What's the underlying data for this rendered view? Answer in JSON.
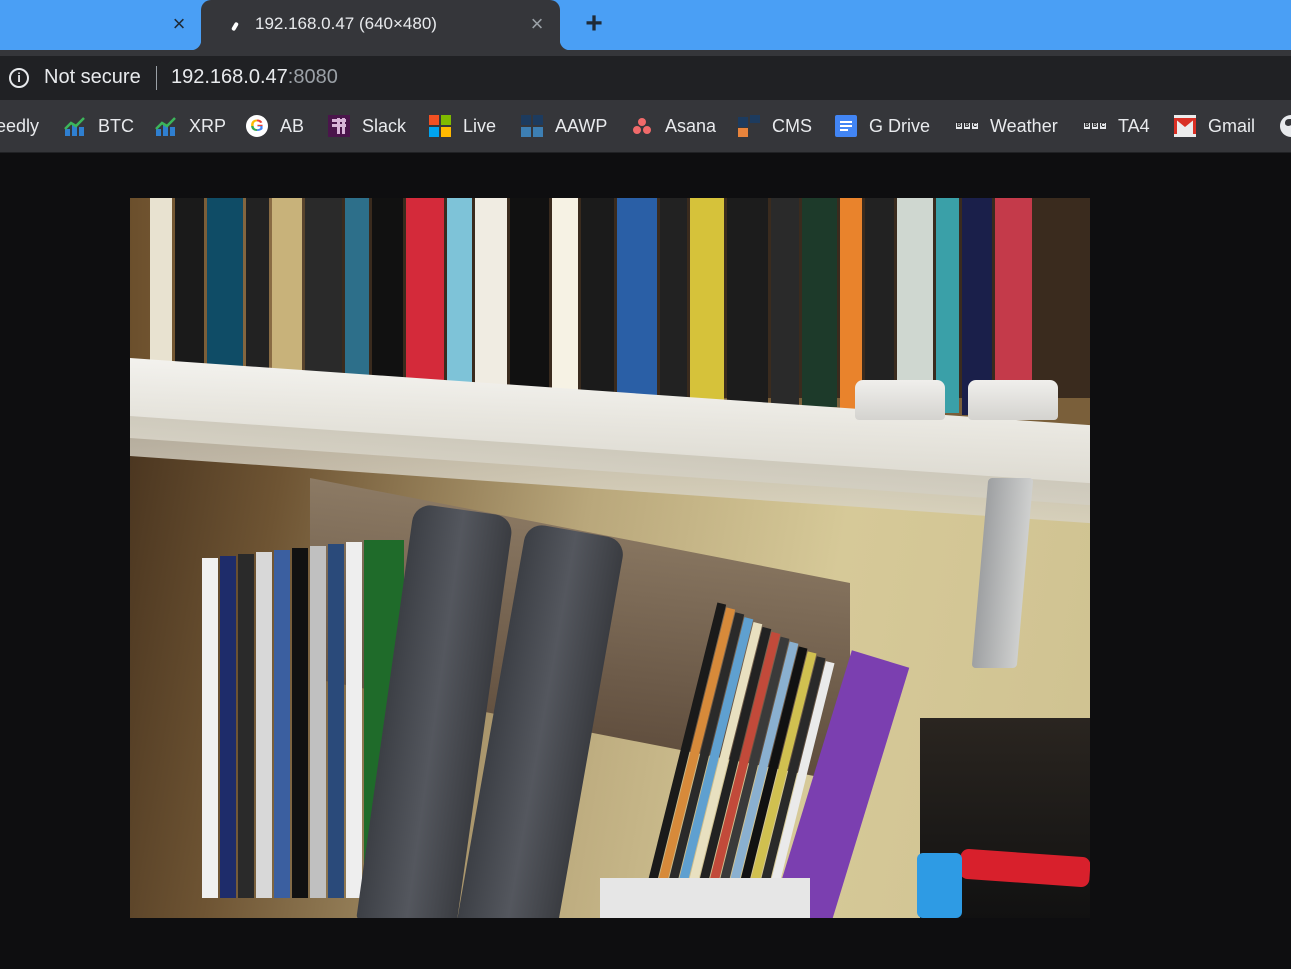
{
  "browser": {
    "tabs": [
      {
        "title": "",
        "active": false,
        "close_glyph": "×"
      },
      {
        "title": "192.168.0.47 (640×480)",
        "active": true,
        "close_glyph": "×",
        "favicon": "image-loading-icon"
      }
    ],
    "new_tab_glyph": "+",
    "accent_color": "#4a9ff5"
  },
  "omnibox": {
    "security_icon": "info-icon",
    "security_label": "Not secure",
    "url_host": "192.168.0.47",
    "url_port": ":8080"
  },
  "bookmarks": [
    {
      "label": "eedly",
      "icon": "feedly-icon"
    },
    {
      "label": "BTC",
      "icon": "chart-icon"
    },
    {
      "label": "XRP",
      "icon": "chart-icon"
    },
    {
      "label": "AB",
      "icon": "google-icon"
    },
    {
      "label": "Slack",
      "icon": "slack-icon"
    },
    {
      "label": "Live",
      "icon": "microsoft-icon"
    },
    {
      "label": "AAWP",
      "icon": "aawp-icon"
    },
    {
      "label": "Asana",
      "icon": "asana-icon"
    },
    {
      "label": "CMS",
      "icon": "cms-icon"
    },
    {
      "label": "G Drive",
      "icon": "google-docs-icon"
    },
    {
      "label": "Weather",
      "icon": "bbc-icon"
    },
    {
      "label": "TA4",
      "icon": "bbc-icon"
    },
    {
      "label": "Gmail",
      "icon": "gmail-icon"
    },
    {
      "label": "",
      "icon": "globe-icon"
    }
  ],
  "page": {
    "image_description": "Webcam image of a bookshelf with books, binders and magazines",
    "image_resolution": "640×480"
  }
}
